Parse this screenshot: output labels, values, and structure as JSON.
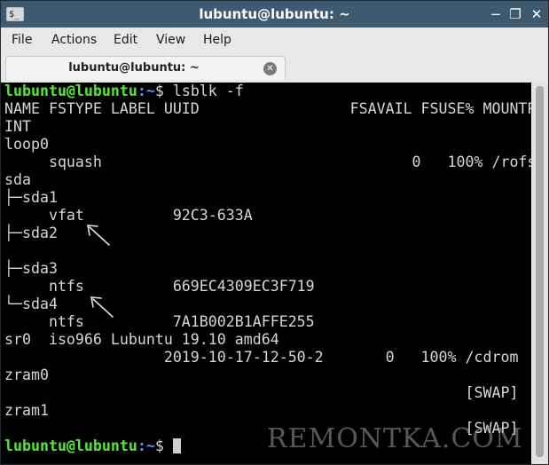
{
  "window": {
    "title": "lubuntu@lubuntu: ~",
    "app_icon_text": "$_",
    "minimize_glyph": "−",
    "maximize_glyph": "❐",
    "close_glyph": "✕"
  },
  "menu": {
    "items": [
      "File",
      "Actions",
      "Edit",
      "View",
      "Help"
    ]
  },
  "tab": {
    "label": "lubuntu@lubuntu: ~",
    "close_glyph": "✕"
  },
  "terminal": {
    "prompt_user": "lubuntu@lubuntu",
    "prompt_path": ":~",
    "prompt_sign": "$",
    "command": " lsblk -f",
    "lines": [
      "NAME FSTYPE LABEL UUID                 FSAVAIL FSUSE% MOUNTPO",
      "INT",
      "loop0",
      "     squash                                   0   100% /rofs",
      "sda",
      "├─sda1",
      "     vfat          92C3-633A",
      "├─sda2",
      "",
      "├─sda3",
      "     ntfs          669EC4309EC3F719",
      "└─sda4",
      "     ntfs          7A1B002B1AFFE255",
      "sr0  iso966 Lubuntu 19.10 amd64",
      "                  2019-10-17-12-50-2       0   100% /cdrom",
      "zram0",
      "                                                    [SWAP]",
      "zram1",
      "                                                    [SWAP]"
    ]
  },
  "watermark": "REMONTKA.COM"
}
